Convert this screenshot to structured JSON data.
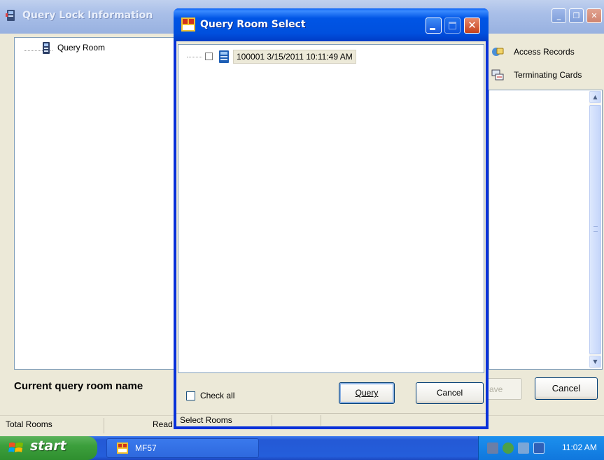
{
  "main_window": {
    "title": "Query Lock Information",
    "tree": {
      "node_label": "Query Room"
    },
    "side_buttons": {
      "access_records": "Access Records",
      "terminating_cards": "Terminating Cards"
    },
    "current_label": "Current query room name",
    "save_button": "ave",
    "cancel_button": "Cancel",
    "status": {
      "total_rooms": "Total Rooms",
      "read": "Read"
    }
  },
  "dialog": {
    "title": "Query Room Select",
    "room_item": {
      "label": "100001 3/15/2011 10:11:49 AM",
      "checked": false
    },
    "check_all": {
      "label": "Check all",
      "checked": false
    },
    "query_button": "Query",
    "cancel_button": "Cancel",
    "status": "Select Rooms"
  },
  "taskbar": {
    "start": "start",
    "task_item": "MF57",
    "clock": "11:02 AM"
  },
  "colors": {
    "xp_blue": "#0055e5",
    "start_green": "#3c9f3c",
    "close_red": "#c6401b"
  }
}
